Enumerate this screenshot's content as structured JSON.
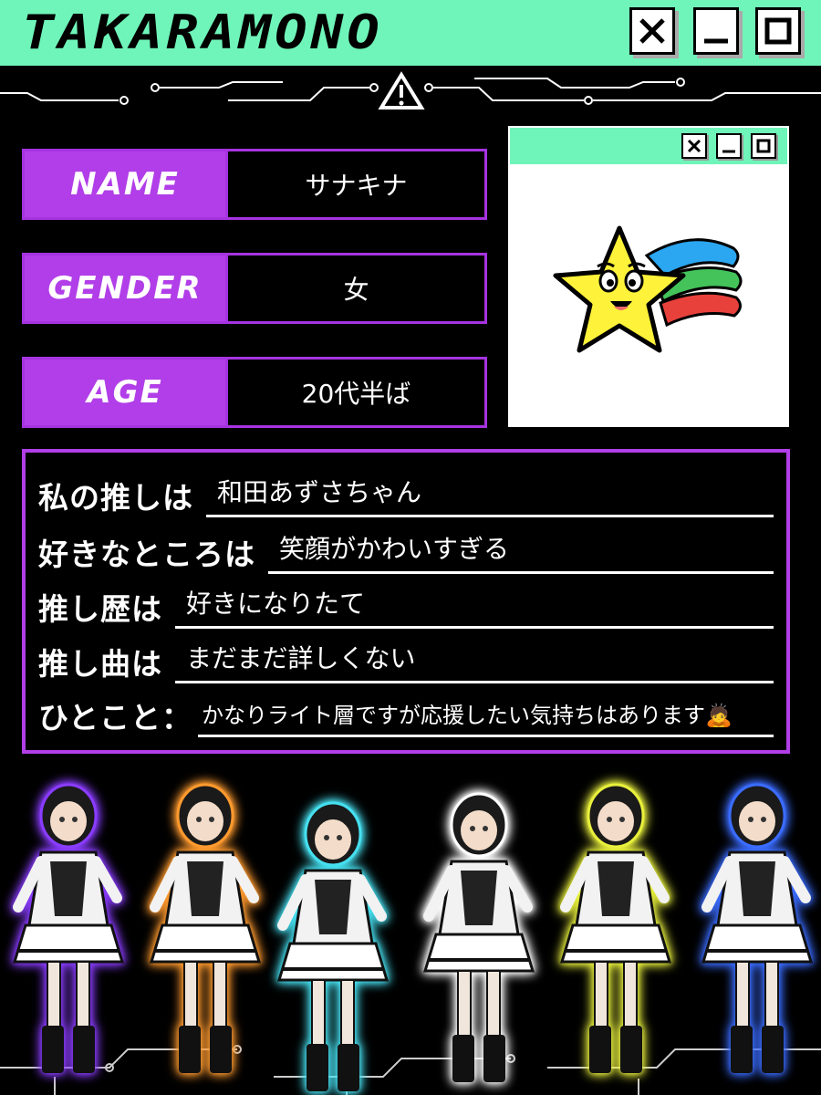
{
  "window": {
    "title": "TAKARAMONO",
    "buttons": {
      "close": "close-icon",
      "minimize": "minimize-icon",
      "maximize": "maximize-icon"
    }
  },
  "profile": {
    "name_label": "NAME",
    "name_value": "サナキナ",
    "gender_label": "GENDER",
    "gender_value": "女",
    "age_label": "AGE",
    "age_value": "20代半ば"
  },
  "qa": [
    {
      "q": "私の推しは",
      "a": "和田あずさちゃん"
    },
    {
      "q": "好きなところは",
      "a": "笑顔がかわいすぎる"
    },
    {
      "q": "推し歴は",
      "a": "好きになりたて"
    },
    {
      "q": "推し曲は",
      "a": "まだまだ詳しくない"
    },
    {
      "q": "ひとこと：",
      "a": "かなりライト層ですが応援したい気持ちはあります🙇"
    }
  ],
  "characters": [
    {
      "glow": "#8a3cff"
    },
    {
      "glow": "#ff9a2e"
    },
    {
      "glow": "#46e0f0"
    },
    {
      "glow": "#ffffff"
    },
    {
      "glow": "#e8f03c"
    },
    {
      "glow": "#3a6cff"
    }
  ],
  "colors": {
    "accent_green": "#6ff5b9",
    "accent_purple": "#b13ee8",
    "background": "#000000"
  }
}
